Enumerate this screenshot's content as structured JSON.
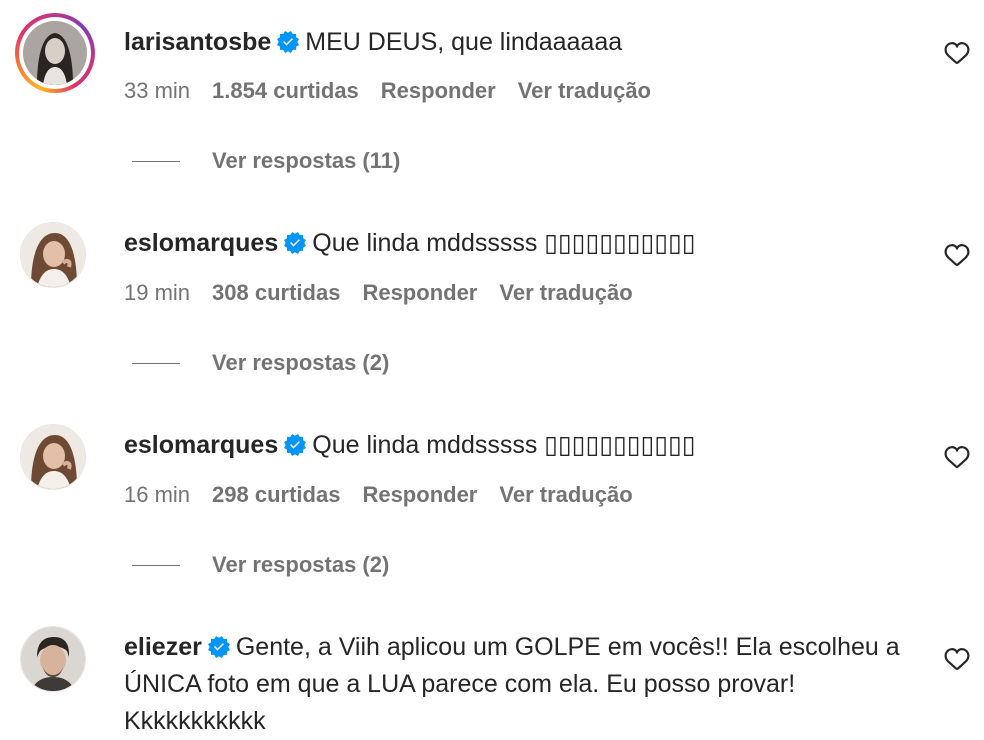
{
  "comments": [
    {
      "username": "larisantosbe",
      "text": "MEU DEUS, que lindaaaaaa",
      "time": "33 min",
      "likes": "1.854 curtidas",
      "reply": "Responder",
      "translate": "Ver tradução",
      "view_replies": "Ver respostas (11)"
    },
    {
      "username": "eslomarques",
      "text": "Que linda mddsssss ▯▯▯▯▯▯▯▯▯▯▯",
      "time": "19 min",
      "likes": "308 curtidas",
      "reply": "Responder",
      "translate": "Ver tradução",
      "view_replies": "Ver respostas (2)"
    },
    {
      "username": "eslomarques",
      "text": "Que linda mddsssss ▯▯▯▯▯▯▯▯▯▯▯",
      "time": "16 min",
      "likes": "298 curtidas",
      "reply": "Responder",
      "translate": "Ver tradução",
      "view_replies": "Ver respostas (2)"
    },
    {
      "username": "eliezer",
      "text": "Gente, a Viih aplicou um GOLPE em vocês!! Ela escolheu a ÚNICA foto em que a LUA parece com ela. Eu posso provar! Kkkkkkkkkkk"
    }
  ],
  "colors": {
    "verified": "#0095f6",
    "meta": "#737373",
    "text": "#262626"
  },
  "icons": {
    "verified": "verified-badge-icon",
    "like": "heart-outline-icon"
  }
}
